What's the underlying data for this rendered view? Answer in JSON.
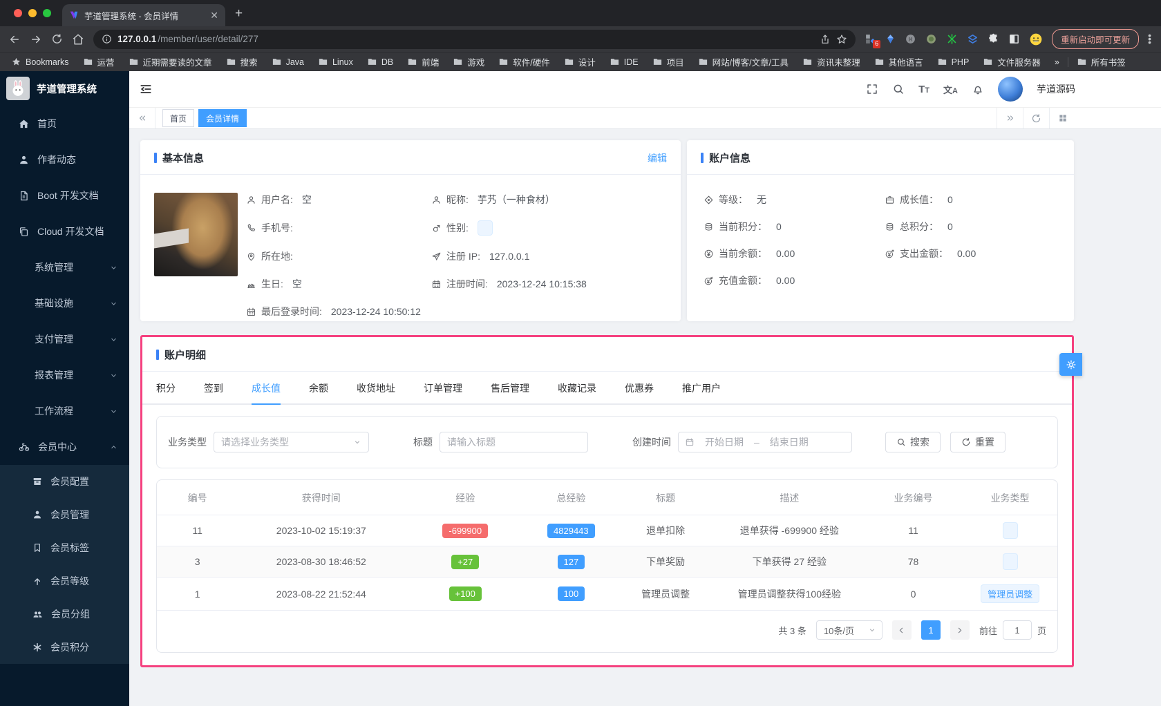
{
  "browser": {
    "tab_title": "芋道管理系统 - 会员详情",
    "url_host": "127.0.0.1",
    "url_path": "/member/user/detail/277",
    "update_button": "重新启动即可更新",
    "ext_badge": "6",
    "bookmarks_label": "Bookmarks",
    "bookmarks": [
      "运营",
      "近期需要读的文章",
      "搜索",
      "Java",
      "Linux",
      "DB",
      "前端",
      "游戏",
      "软件/硬件",
      "设计",
      "IDE",
      "项目",
      "网站/博客/文章/工具",
      "资讯未整理",
      "其他语言",
      "PHP",
      "文件服务器"
    ],
    "more_symbol": "»",
    "all_bookmarks": "所有书签"
  },
  "sidebar": {
    "logo_title": "芋道管理系统",
    "items": [
      {
        "label": "首页"
      },
      {
        "label": "作者动态"
      },
      {
        "label": "Boot 开发文档"
      },
      {
        "label": "Cloud 开发文档"
      },
      {
        "label": "系统管理"
      },
      {
        "label": "基础设施"
      },
      {
        "label": "支付管理"
      },
      {
        "label": "报表管理"
      },
      {
        "label": "工作流程"
      },
      {
        "label": "会员中心"
      }
    ],
    "sub": [
      {
        "label": "会员配置"
      },
      {
        "label": "会员管理"
      },
      {
        "label": "会员标签"
      },
      {
        "label": "会员等级"
      },
      {
        "label": "会员分组"
      },
      {
        "label": "会员积分"
      }
    ]
  },
  "header": {
    "username": "芋道源码"
  },
  "tags": {
    "home": "首页",
    "active": "会员详情"
  },
  "basic_info": {
    "title": "基本信息",
    "edit": "编辑",
    "username_label": "用户名:",
    "username_value": "空",
    "nickname_label": "昵称:",
    "nickname_value": "芋艿（一种食材）",
    "mobile_label": "手机号:",
    "gender_label": "性别:",
    "area_label": "所在地:",
    "ip_label": "注册 IP:",
    "ip_value": "127.0.0.1",
    "birthday_label": "生日:",
    "birthday_value": "空",
    "register_label": "注册时间:",
    "register_value": "2023-12-24 10:15:38",
    "last_login_label": "最后登录时间:",
    "last_login_value": "2023-12-24 10:50:12"
  },
  "account_info": {
    "title": "账户信息",
    "level_label": "等级：",
    "level_value": "无",
    "growth_label": "成长值：",
    "growth_value": "0",
    "points_label": "当前积分：",
    "points_value": "0",
    "total_points_label": "总积分：",
    "total_points_value": "0",
    "balance_label": "当前余额：",
    "balance_value": "0.00",
    "expense_label": "支出金额：",
    "expense_value": "0.00",
    "recharge_label": "充值金额：",
    "recharge_value": "0.00"
  },
  "account_detail": {
    "title": "账户明细",
    "tabs": [
      "积分",
      "签到",
      "成长值",
      "余额",
      "收货地址",
      "订单管理",
      "售后管理",
      "收藏记录",
      "优惠券",
      "推广用户"
    ],
    "active_tab": "成长值",
    "filter": {
      "biz_type_label": "业务类型",
      "biz_type_placeholder": "请选择业务类型",
      "title_label": "标题",
      "title_placeholder": "请输入标题",
      "time_label": "创建时间",
      "start_placeholder": "开始日期",
      "separator": "–",
      "end_placeholder": "结束日期",
      "search": "搜索",
      "reset": "重置"
    },
    "table": {
      "columns": [
        "编号",
        "获得时间",
        "经验",
        "总经验",
        "标题",
        "描述",
        "业务编号",
        "业务类型"
      ],
      "rows": [
        {
          "id": "11",
          "time": "2023-10-02 15:19:37",
          "exp": "-699900",
          "total": "4829443",
          "title": "退单扣除",
          "desc": "退单获得 -699900 经验",
          "biz_id": "11",
          "biz_type": ""
        },
        {
          "id": "3",
          "time": "2023-08-30 18:46:52",
          "exp": "+27",
          "total": "127",
          "title": "下单奖励",
          "desc": "下单获得 27 经验",
          "biz_id": "78",
          "biz_type": ""
        },
        {
          "id": "1",
          "time": "2023-08-22 21:52:44",
          "exp": "+100",
          "total": "100",
          "title": "管理员调整",
          "desc": "管理员调整获得100经验",
          "biz_id": "0",
          "biz_type": "管理员调整"
        }
      ]
    },
    "pagination": {
      "total": "共 3 条",
      "page_size": "10条/页",
      "current": "1",
      "goto_label": "前往",
      "goto_value": "1",
      "unit": "页"
    }
  },
  "colors": {
    "accent": "#409eff",
    "highlight_border": "#f5417f",
    "danger": "#f56c6c",
    "success": "#67c23a"
  }
}
